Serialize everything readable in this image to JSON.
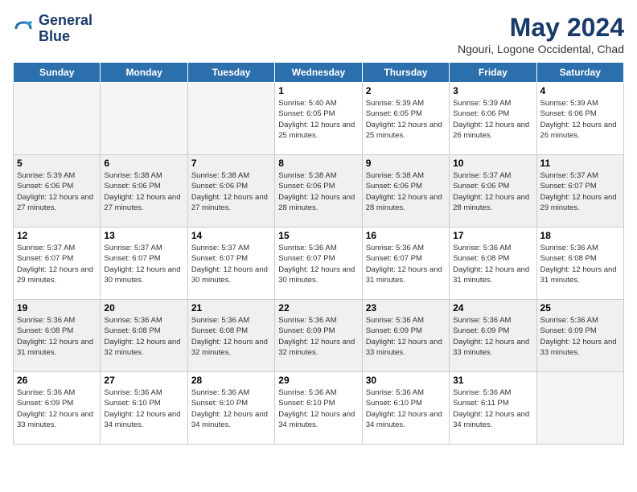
{
  "logo": {
    "line1": "General",
    "line2": "Blue"
  },
  "title": "May 2024",
  "subtitle": "Ngouri, Logone Occidental, Chad",
  "headers": [
    "Sunday",
    "Monday",
    "Tuesday",
    "Wednesday",
    "Thursday",
    "Friday",
    "Saturday"
  ],
  "weeks": [
    [
      {
        "day": "",
        "info": "",
        "empty": true
      },
      {
        "day": "",
        "info": "",
        "empty": true
      },
      {
        "day": "",
        "info": "",
        "empty": true
      },
      {
        "day": "1",
        "info": "Sunrise: 5:40 AM\nSunset: 6:05 PM\nDaylight: 12 hours\nand 25 minutes."
      },
      {
        "day": "2",
        "info": "Sunrise: 5:39 AM\nSunset: 6:05 PM\nDaylight: 12 hours\nand 25 minutes."
      },
      {
        "day": "3",
        "info": "Sunrise: 5:39 AM\nSunset: 6:06 PM\nDaylight: 12 hours\nand 26 minutes."
      },
      {
        "day": "4",
        "info": "Sunrise: 5:39 AM\nSunset: 6:06 PM\nDaylight: 12 hours\nand 26 minutes."
      }
    ],
    [
      {
        "day": "5",
        "info": "Sunrise: 5:39 AM\nSunset: 6:06 PM\nDaylight: 12 hours\nand 27 minutes."
      },
      {
        "day": "6",
        "info": "Sunrise: 5:38 AM\nSunset: 6:06 PM\nDaylight: 12 hours\nand 27 minutes."
      },
      {
        "day": "7",
        "info": "Sunrise: 5:38 AM\nSunset: 6:06 PM\nDaylight: 12 hours\nand 27 minutes."
      },
      {
        "day": "8",
        "info": "Sunrise: 5:38 AM\nSunset: 6:06 PM\nDaylight: 12 hours\nand 28 minutes."
      },
      {
        "day": "9",
        "info": "Sunrise: 5:38 AM\nSunset: 6:06 PM\nDaylight: 12 hours\nand 28 minutes."
      },
      {
        "day": "10",
        "info": "Sunrise: 5:37 AM\nSunset: 6:06 PM\nDaylight: 12 hours\nand 28 minutes."
      },
      {
        "day": "11",
        "info": "Sunrise: 5:37 AM\nSunset: 6:07 PM\nDaylight: 12 hours\nand 29 minutes."
      }
    ],
    [
      {
        "day": "12",
        "info": "Sunrise: 5:37 AM\nSunset: 6:07 PM\nDaylight: 12 hours\nand 29 minutes."
      },
      {
        "day": "13",
        "info": "Sunrise: 5:37 AM\nSunset: 6:07 PM\nDaylight: 12 hours\nand 30 minutes."
      },
      {
        "day": "14",
        "info": "Sunrise: 5:37 AM\nSunset: 6:07 PM\nDaylight: 12 hours\nand 30 minutes."
      },
      {
        "day": "15",
        "info": "Sunrise: 5:36 AM\nSunset: 6:07 PM\nDaylight: 12 hours\nand 30 minutes."
      },
      {
        "day": "16",
        "info": "Sunrise: 5:36 AM\nSunset: 6:07 PM\nDaylight: 12 hours\nand 31 minutes."
      },
      {
        "day": "17",
        "info": "Sunrise: 5:36 AM\nSunset: 6:08 PM\nDaylight: 12 hours\nand 31 minutes."
      },
      {
        "day": "18",
        "info": "Sunrise: 5:36 AM\nSunset: 6:08 PM\nDaylight: 12 hours\nand 31 minutes."
      }
    ],
    [
      {
        "day": "19",
        "info": "Sunrise: 5:36 AM\nSunset: 6:08 PM\nDaylight: 12 hours\nand 31 minutes."
      },
      {
        "day": "20",
        "info": "Sunrise: 5:36 AM\nSunset: 6:08 PM\nDaylight: 12 hours\nand 32 minutes."
      },
      {
        "day": "21",
        "info": "Sunrise: 5:36 AM\nSunset: 6:08 PM\nDaylight: 12 hours\nand 32 minutes."
      },
      {
        "day": "22",
        "info": "Sunrise: 5:36 AM\nSunset: 6:09 PM\nDaylight: 12 hours\nand 32 minutes."
      },
      {
        "day": "23",
        "info": "Sunrise: 5:36 AM\nSunset: 6:09 PM\nDaylight: 12 hours\nand 33 minutes."
      },
      {
        "day": "24",
        "info": "Sunrise: 5:36 AM\nSunset: 6:09 PM\nDaylight: 12 hours\nand 33 minutes."
      },
      {
        "day": "25",
        "info": "Sunrise: 5:36 AM\nSunset: 6:09 PM\nDaylight: 12 hours\nand 33 minutes."
      }
    ],
    [
      {
        "day": "26",
        "info": "Sunrise: 5:36 AM\nSunset: 6:09 PM\nDaylight: 12 hours\nand 33 minutes."
      },
      {
        "day": "27",
        "info": "Sunrise: 5:36 AM\nSunset: 6:10 PM\nDaylight: 12 hours\nand 34 minutes."
      },
      {
        "day": "28",
        "info": "Sunrise: 5:36 AM\nSunset: 6:10 PM\nDaylight: 12 hours\nand 34 minutes."
      },
      {
        "day": "29",
        "info": "Sunrise: 5:36 AM\nSunset: 6:10 PM\nDaylight: 12 hours\nand 34 minutes."
      },
      {
        "day": "30",
        "info": "Sunrise: 5:36 AM\nSunset: 6:10 PM\nDaylight: 12 hours\nand 34 minutes."
      },
      {
        "day": "31",
        "info": "Sunrise: 5:36 AM\nSunset: 6:11 PM\nDaylight: 12 hours\nand 34 minutes."
      },
      {
        "day": "",
        "info": "",
        "empty": true
      }
    ]
  ]
}
